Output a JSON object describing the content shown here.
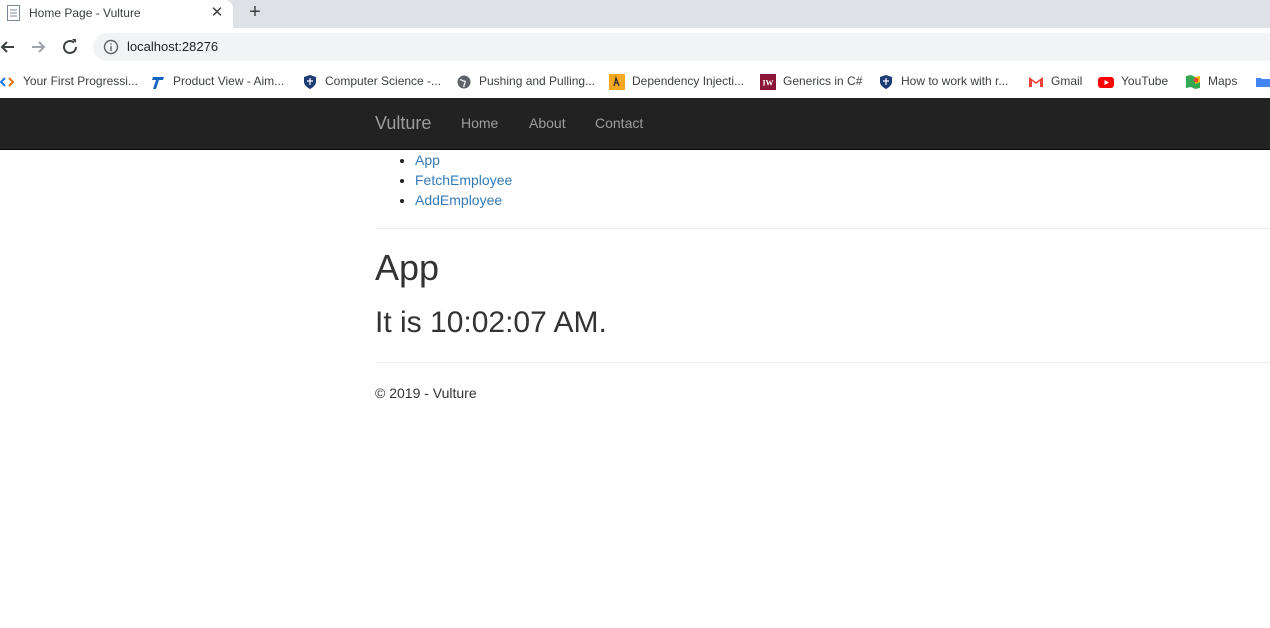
{
  "browser": {
    "tab": {
      "title": "Home Page - Vulture",
      "close": "✕",
      "new_tab": "+"
    },
    "url": "localhost:28276",
    "bookmarks": [
      {
        "label": "Your First Progressi...",
        "icon": "code-icon"
      },
      {
        "label": "Product View - Aim...",
        "icon": "product-icon"
      },
      {
        "label": "Computer Science -...",
        "icon": "shield-icon"
      },
      {
        "label": "Pushing and Pulling...",
        "icon": "globe-icon"
      },
      {
        "label": "Dependency Injecti...",
        "icon": "di-icon"
      },
      {
        "label": "Generics in C#",
        "icon": "iw-icon"
      },
      {
        "label": "How to work with r...",
        "icon": "shield-icon"
      },
      {
        "label": "Gmail",
        "icon": "gmail-icon"
      },
      {
        "label": "YouTube",
        "icon": "youtube-icon"
      },
      {
        "label": "Maps",
        "icon": "maps-icon"
      }
    ]
  },
  "navbar": {
    "brand": "Vulture",
    "links": [
      "Home",
      "About",
      "Contact"
    ]
  },
  "side_menu": [
    "App",
    "FetchEmployee",
    "AddEmployee"
  ],
  "main": {
    "heading": "App",
    "time_text": "It is 10:02:07 AM."
  },
  "footer": "© 2019 - Vulture",
  "colors": {
    "navbar_bg": "#222222",
    "nav_text": "#9d9d9d",
    "link": "#337ab7"
  }
}
